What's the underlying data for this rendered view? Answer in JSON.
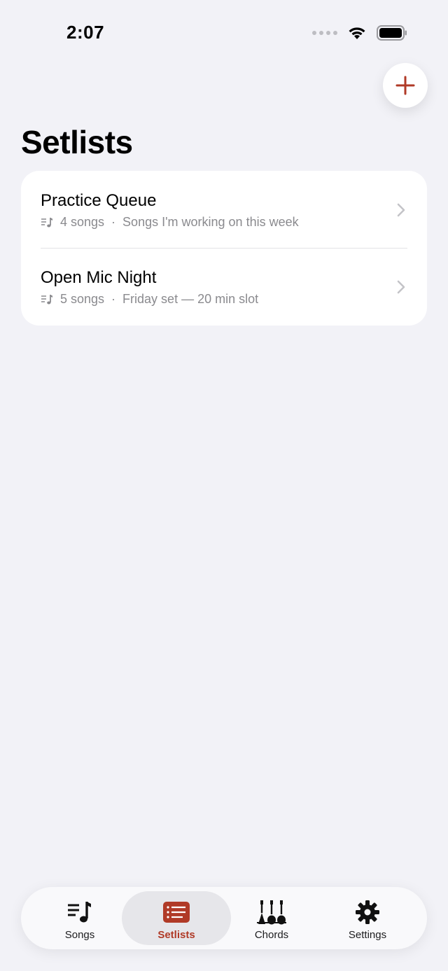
{
  "status": {
    "time": "2:07"
  },
  "header": {
    "title": "Setlists"
  },
  "setlists": [
    {
      "title": "Practice Queue",
      "count": "4 songs",
      "separator": "·",
      "description": "Songs I'm working on this week"
    },
    {
      "title": "Open Mic Night",
      "count": "5 songs",
      "separator": "·",
      "description": "Friday set — 20 min slot"
    }
  ],
  "tabs": [
    {
      "label": "Songs",
      "icon": "music-list-icon"
    },
    {
      "label": "Setlists",
      "icon": "setlist-icon",
      "active": true
    },
    {
      "label": "Chords",
      "icon": "guitars-icon"
    },
    {
      "label": "Settings",
      "icon": "gear-icon"
    }
  ],
  "colors": {
    "accent": "#b03a27",
    "background": "#f2f2f7",
    "card": "#ffffff",
    "secondary_text": "#8a8a8e"
  }
}
